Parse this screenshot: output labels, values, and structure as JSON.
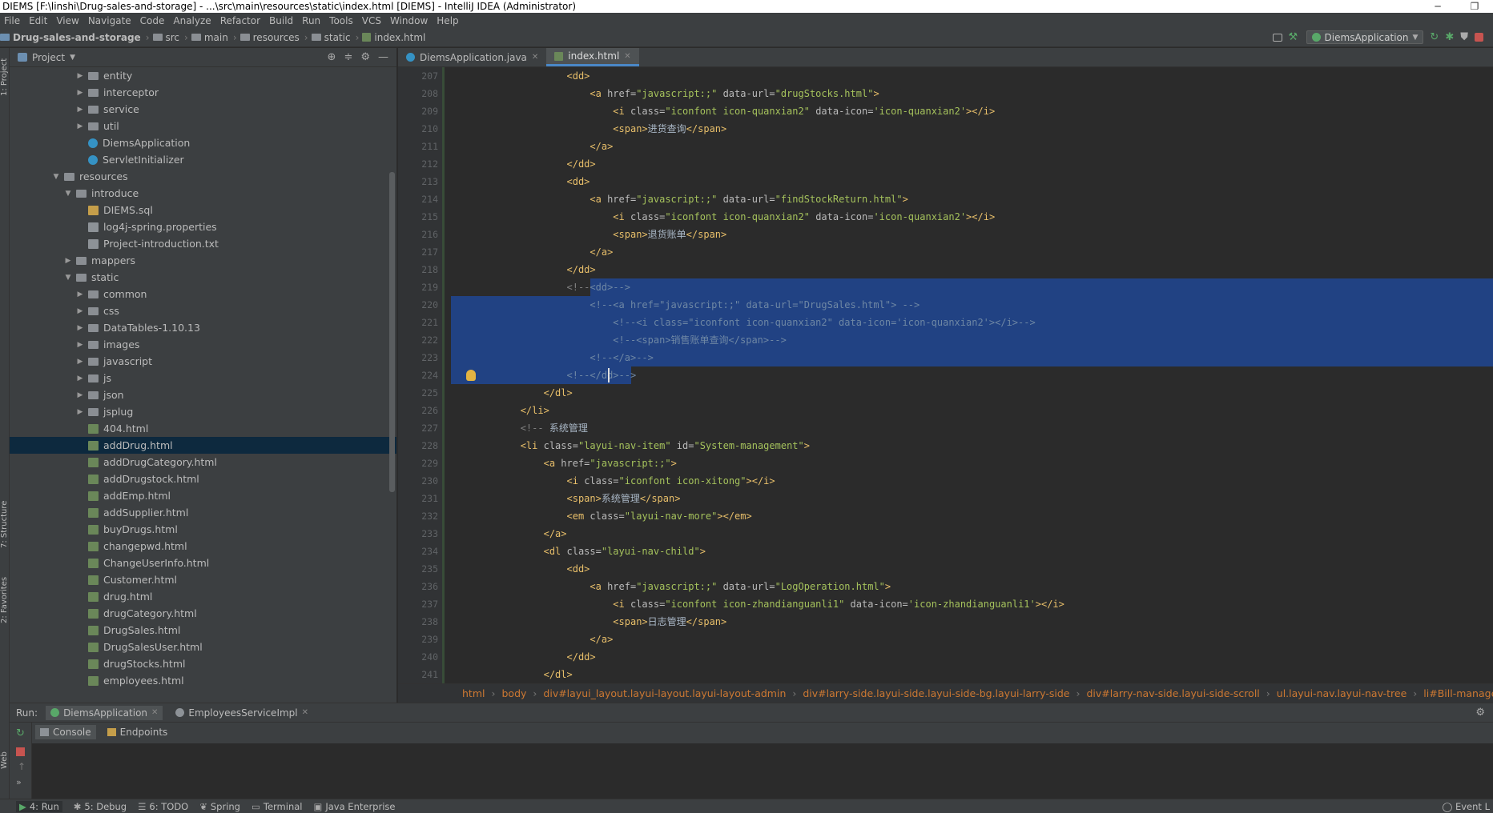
{
  "window": {
    "title": "DIEMS [F:\\linshi\\Drug-sales-and-storage] - ...\\src\\main\\resources\\static\\index.html [DIEMS] - IntelliJ IDEA (Administrator)"
  },
  "menu": [
    "File",
    "Edit",
    "View",
    "Navigate",
    "Code",
    "Analyze",
    "Refactor",
    "Build",
    "Run",
    "Tools",
    "VCS",
    "Window",
    "Help"
  ],
  "nav": {
    "crumbs": [
      "Drug-sales-and-storage",
      "src",
      "main",
      "resources",
      "static",
      "index.html"
    ],
    "run_config": "DiemsApplication"
  },
  "project": {
    "header": "Project",
    "tree": [
      {
        "label": "entity",
        "depth": 3,
        "type": "folder",
        "expanded": false
      },
      {
        "label": "interceptor",
        "depth": 3,
        "type": "folder",
        "expanded": false
      },
      {
        "label": "service",
        "depth": 3,
        "type": "folder",
        "expanded": false
      },
      {
        "label": "util",
        "depth": 3,
        "type": "folder",
        "expanded": false
      },
      {
        "label": "DiemsApplication",
        "depth": 3,
        "type": "java"
      },
      {
        "label": "ServletInitializer",
        "depth": 3,
        "type": "java"
      },
      {
        "label": "resources",
        "depth": 1,
        "type": "folder",
        "expanded": true
      },
      {
        "label": "introduce",
        "depth": 2,
        "type": "folder",
        "expanded": true
      },
      {
        "label": "DIEMS.sql",
        "depth": 3,
        "type": "sql"
      },
      {
        "label": "log4j-spring.properties",
        "depth": 3,
        "type": "txt"
      },
      {
        "label": "Project-introduction.txt",
        "depth": 3,
        "type": "txt"
      },
      {
        "label": "mappers",
        "depth": 2,
        "type": "folder",
        "expanded": false
      },
      {
        "label": "static",
        "depth": 2,
        "type": "folder",
        "expanded": true
      },
      {
        "label": "common",
        "depth": 3,
        "type": "folder",
        "expanded": false
      },
      {
        "label": "css",
        "depth": 3,
        "type": "folder",
        "expanded": false
      },
      {
        "label": "DataTables-1.10.13",
        "depth": 3,
        "type": "folder",
        "expanded": false
      },
      {
        "label": "images",
        "depth": 3,
        "type": "folder",
        "expanded": false
      },
      {
        "label": "javascript",
        "depth": 3,
        "type": "folder",
        "expanded": false
      },
      {
        "label": "js",
        "depth": 3,
        "type": "folder",
        "expanded": false
      },
      {
        "label": "json",
        "depth": 3,
        "type": "folder",
        "expanded": false
      },
      {
        "label": "jsplug",
        "depth": 3,
        "type": "folder",
        "expanded": false
      },
      {
        "label": "404.html",
        "depth": 3,
        "type": "html"
      },
      {
        "label": "addDrug.html",
        "depth": 3,
        "type": "html",
        "selected": true
      },
      {
        "label": "addDrugCategory.html",
        "depth": 3,
        "type": "html"
      },
      {
        "label": "addDrugstock.html",
        "depth": 3,
        "type": "html"
      },
      {
        "label": "addEmp.html",
        "depth": 3,
        "type": "html"
      },
      {
        "label": "addSupplier.html",
        "depth": 3,
        "type": "html"
      },
      {
        "label": "buyDrugs.html",
        "depth": 3,
        "type": "html"
      },
      {
        "label": "changepwd.html",
        "depth": 3,
        "type": "html"
      },
      {
        "label": "ChangeUserInfo.html",
        "depth": 3,
        "type": "html"
      },
      {
        "label": "Customer.html",
        "depth": 3,
        "type": "html"
      },
      {
        "label": "drug.html",
        "depth": 3,
        "type": "html"
      },
      {
        "label": "drugCategory.html",
        "depth": 3,
        "type": "html"
      },
      {
        "label": "DrugSales.html",
        "depth": 3,
        "type": "html"
      },
      {
        "label": "DrugSalesUser.html",
        "depth": 3,
        "type": "html"
      },
      {
        "label": "drugStocks.html",
        "depth": 3,
        "type": "html"
      },
      {
        "label": "employees.html",
        "depth": 3,
        "type": "html"
      }
    ]
  },
  "editor": {
    "tabs": [
      {
        "label": "DiemsApplication.java",
        "active": false
      },
      {
        "label": "index.html",
        "active": true
      }
    ],
    "lines": [
      {
        "n": "207",
        "indent": 20,
        "parts": [
          [
            "tag",
            "<dd>"
          ]
        ]
      },
      {
        "n": "208",
        "indent": 24,
        "parts": [
          [
            "tag",
            "<a "
          ],
          [
            "attr",
            "href="
          ],
          [
            "val",
            "\"javascript:;\""
          ],
          [
            "attr",
            " data-url="
          ],
          [
            "val",
            "\"drugStocks.html\""
          ],
          [
            "tag",
            ">"
          ]
        ]
      },
      {
        "n": "209",
        "indent": 28,
        "parts": [
          [
            "tag",
            "<i "
          ],
          [
            "attr",
            "class="
          ],
          [
            "val",
            "\"iconfont icon-quanxian2\""
          ],
          [
            "attr",
            " data-icon="
          ],
          [
            "val",
            "'icon-quanxian2'"
          ],
          [
            "tag",
            "></i>"
          ]
        ]
      },
      {
        "n": "210",
        "indent": 28,
        "parts": [
          [
            "tag",
            "<span>"
          ],
          [
            "txt",
            "进货查询"
          ],
          [
            "tag",
            "</span>"
          ]
        ]
      },
      {
        "n": "211",
        "indent": 24,
        "parts": [
          [
            "tag",
            "</a>"
          ]
        ]
      },
      {
        "n": "212",
        "indent": 20,
        "parts": [
          [
            "tag",
            "</dd>"
          ]
        ]
      },
      {
        "n": "213",
        "indent": 20,
        "parts": [
          [
            "tag",
            "<dd>"
          ]
        ]
      },
      {
        "n": "214",
        "indent": 24,
        "parts": [
          [
            "tag",
            "<a "
          ],
          [
            "attr",
            "href="
          ],
          [
            "val",
            "\"javascript:;\""
          ],
          [
            "attr",
            " data-url="
          ],
          [
            "val",
            "\"findStockReturn.html\""
          ],
          [
            "tag",
            ">"
          ]
        ]
      },
      {
        "n": "215",
        "indent": 28,
        "parts": [
          [
            "tag",
            "<i "
          ],
          [
            "attr",
            "class="
          ],
          [
            "val",
            "\"iconfont icon-quanxian2\""
          ],
          [
            "attr",
            " data-icon="
          ],
          [
            "val",
            "'icon-quanxian2'"
          ],
          [
            "tag",
            "></i>"
          ]
        ]
      },
      {
        "n": "216",
        "indent": 28,
        "parts": [
          [
            "tag",
            "<span>"
          ],
          [
            "txt",
            "退货账单"
          ],
          [
            "tag",
            "</span>"
          ]
        ]
      },
      {
        "n": "217",
        "indent": 24,
        "parts": [
          [
            "tag",
            "</a>"
          ]
        ]
      },
      {
        "n": "218",
        "indent": 20,
        "parts": [
          [
            "tag",
            "</dd>"
          ]
        ]
      },
      {
        "n": "219",
        "indent": 20,
        "parts": [
          [
            "cmt",
            "<!--"
          ],
          [
            "sel",
            "<dd>-->"
          ]
        ]
      },
      {
        "n": "220",
        "indent": 24,
        "parts": [
          [
            "sel",
            "<!--<a href=\"javascript:;\" data-url=\"DrugSales.html\"> -->"
          ]
        ]
      },
      {
        "n": "221",
        "indent": 28,
        "parts": [
          [
            "sel",
            "<!--<i class=\"iconfont icon-quanxian2\" data-icon='icon-quanxian2'></i>-->"
          ]
        ]
      },
      {
        "n": "222",
        "indent": 28,
        "parts": [
          [
            "sel",
            "<!--<span>销售账单查询</span>-->"
          ]
        ]
      },
      {
        "n": "223",
        "indent": 24,
        "parts": [
          [
            "sel",
            "<!--</a>-->"
          ]
        ]
      },
      {
        "n": "224",
        "indent": 20,
        "parts": [
          [
            "sel",
            "<!--</dd>-->"
          ]
        ]
      },
      {
        "n": "225",
        "indent": 16,
        "parts": [
          [
            "tag",
            "</dl>"
          ]
        ]
      },
      {
        "n": "226",
        "indent": 12,
        "parts": [
          [
            "tag",
            "</li>"
          ]
        ]
      },
      {
        "n": "227",
        "indent": 12,
        "parts": [
          [
            "cmt",
            "<!-- "
          ],
          [
            "txt",
            "系统管理"
          ]
        ]
      },
      {
        "n": "228",
        "indent": 12,
        "parts": [
          [
            "tag",
            "<li "
          ],
          [
            "attr",
            "class="
          ],
          [
            "val",
            "\"layui-nav-item\""
          ],
          [
            "attr",
            " id="
          ],
          [
            "val",
            "\"System-management\""
          ],
          [
            "tag",
            ">"
          ]
        ]
      },
      {
        "n": "229",
        "indent": 16,
        "parts": [
          [
            "tag",
            "<a "
          ],
          [
            "attr",
            "href="
          ],
          [
            "val",
            "\"javascript:;\""
          ],
          [
            "tag",
            ">"
          ]
        ]
      },
      {
        "n": "230",
        "indent": 20,
        "parts": [
          [
            "tag",
            "<i "
          ],
          [
            "attr",
            "class="
          ],
          [
            "val",
            "\"iconfont icon-xitong\""
          ],
          [
            "tag",
            "></i>"
          ]
        ]
      },
      {
        "n": "231",
        "indent": 20,
        "parts": [
          [
            "tag",
            "<span>"
          ],
          [
            "txt",
            "系统管理"
          ],
          [
            "tag",
            "</span>"
          ]
        ]
      },
      {
        "n": "232",
        "indent": 20,
        "parts": [
          [
            "tag",
            "<em "
          ],
          [
            "attr",
            "class="
          ],
          [
            "val",
            "\"layui-nav-more\""
          ],
          [
            "tag",
            "></em>"
          ]
        ]
      },
      {
        "n": "233",
        "indent": 16,
        "parts": [
          [
            "tag",
            "</a>"
          ]
        ]
      },
      {
        "n": "234",
        "indent": 16,
        "parts": [
          [
            "tag",
            "<dl "
          ],
          [
            "attr",
            "class="
          ],
          [
            "val",
            "\"layui-nav-child\""
          ],
          [
            "tag",
            ">"
          ]
        ]
      },
      {
        "n": "235",
        "indent": 20,
        "parts": [
          [
            "tag",
            "<dd>"
          ]
        ]
      },
      {
        "n": "236",
        "indent": 24,
        "parts": [
          [
            "tag",
            "<a "
          ],
          [
            "attr",
            "href="
          ],
          [
            "val",
            "\"javascript:;\""
          ],
          [
            "attr",
            " data-url="
          ],
          [
            "val",
            "\"LogOperation.html\""
          ],
          [
            "tag",
            ">"
          ]
        ]
      },
      {
        "n": "237",
        "indent": 28,
        "parts": [
          [
            "tag",
            "<i "
          ],
          [
            "attr",
            "class="
          ],
          [
            "val",
            "\"iconfont icon-zhandianguanli1\""
          ],
          [
            "attr",
            " data-icon="
          ],
          [
            "val",
            "'icon-zhandianguanli1'"
          ],
          [
            "tag",
            "></i>"
          ]
        ]
      },
      {
        "n": "238",
        "indent": 28,
        "parts": [
          [
            "tag",
            "<span>"
          ],
          [
            "txt",
            "日志管理"
          ],
          [
            "tag",
            "</span>"
          ]
        ]
      },
      {
        "n": "239",
        "indent": 24,
        "parts": [
          [
            "tag",
            "</a>"
          ]
        ]
      },
      {
        "n": "240",
        "indent": 20,
        "parts": [
          [
            "tag",
            "</dd>"
          ]
        ]
      },
      {
        "n": "241",
        "indent": 16,
        "parts": [
          [
            "tag",
            "</dl>"
          ]
        ]
      }
    ]
  },
  "breadcrumbs": [
    "html",
    "body",
    "div#layui_layout.layui-layout.layui-layout-admin",
    "div#larry-side.layui-side.layui-side-bg.layui-larry-side",
    "div#larry-nav-side.layui-side-scroll",
    "ul.layui-nav.layui-nav-tree",
    "li#Bill-management.layui-nav"
  ],
  "run": {
    "label": "Run:",
    "tabs": [
      "DiemsApplication",
      "EmployeesServiceImpl"
    ],
    "subtabs": [
      "Console",
      "Endpoints"
    ]
  },
  "tool_windows_left": [
    "1: Project",
    "7: Structure",
    "2: Favorites",
    "Web"
  ],
  "status": {
    "items": [
      "4: Run",
      "5: Debug",
      "6: TODO",
      "Spring",
      "Terminal",
      "Java Enterprise"
    ],
    "event_log": "Event L"
  },
  "colors": {
    "accent": "#4a88c7",
    "selection": "#214283",
    "tag": "#e8bf6a",
    "value": "#a5c25c"
  }
}
